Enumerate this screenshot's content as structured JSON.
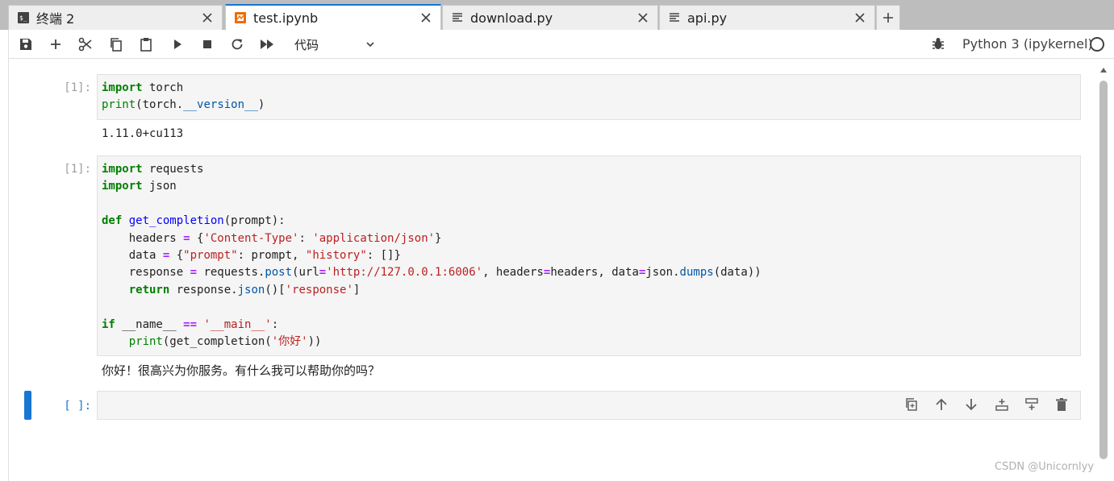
{
  "tabs": [
    {
      "label": "终端 2",
      "icon": "terminal-icon",
      "active": false
    },
    {
      "label": "test.ipynb",
      "icon": "notebook-icon",
      "active": true
    },
    {
      "label": "download.py",
      "icon": "file-icon",
      "active": false
    },
    {
      "label": "api.py",
      "icon": "file-icon",
      "active": false
    }
  ],
  "toolbar": {
    "cell_type": "代码",
    "kernel_name": "Python 3 (ipykernel)",
    "icons": [
      "save-icon",
      "add-icon",
      "cut-icon",
      "copy-icon",
      "paste-icon",
      "run-icon",
      "stop-icon",
      "restart-icon",
      "run-all-icon"
    ]
  },
  "cells": [
    {
      "prompt": "[1]:",
      "code_lines": [
        "import torch",
        "print(torch.__version__)"
      ],
      "output": "1.11.0+cu113"
    },
    {
      "prompt": "[1]:",
      "code_lines": [
        "import requests",
        "import json",
        "",
        "def get_completion(prompt):",
        "    headers = {'Content-Type': 'application/json'}",
        "    data = {\"prompt\": prompt, \"history\": []}",
        "    response = requests.post(url='http://127.0.0.1:6006', headers=headers, data=json.dumps(data))",
        "    return response.json()['response']",
        "",
        "if __name__ == '__main__':",
        "    print(get_completion('你好'))"
      ],
      "output": "你好！很高兴为你服务。有什么我可以帮助你的吗？"
    },
    {
      "prompt": "[ ]:",
      "code_lines": [],
      "output": ""
    }
  ],
  "watermark": "CSDN @Unicornlyy",
  "colors": {
    "accent": "#1976d2",
    "keyword": "#008000",
    "string": "#ba2121",
    "function": "#0000ff"
  }
}
